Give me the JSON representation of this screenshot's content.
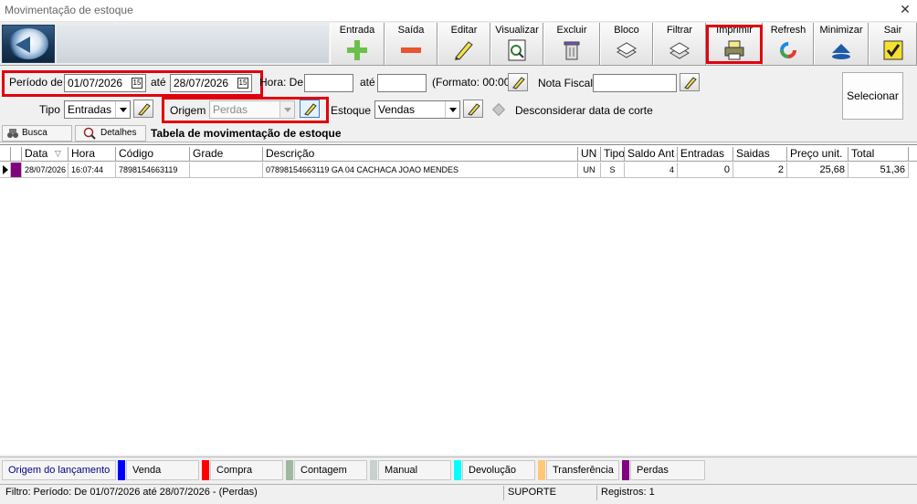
{
  "window": {
    "title": "Movimentação de estoque"
  },
  "toolbar": {
    "buttons": [
      {
        "label": "Entrada",
        "icon": "plus-icon"
      },
      {
        "label": "Saída",
        "icon": "minus-icon"
      },
      {
        "label": "Editar",
        "icon": "pencil-icon"
      },
      {
        "label": "Visualizar",
        "icon": "preview-icon"
      },
      {
        "label": "Excluir",
        "icon": "trash-icon"
      },
      {
        "label": "Bloco",
        "icon": "block-icon"
      },
      {
        "label": "Filtrar",
        "icon": "filter-icon"
      },
      {
        "label": "Imprimir",
        "icon": "printer-icon"
      },
      {
        "label": "Refresh",
        "icon": "refresh-icon"
      },
      {
        "label": "Minimizar",
        "icon": "minimize-icon"
      },
      {
        "label": "Sair",
        "icon": "exit-checkmark-icon"
      }
    ]
  },
  "filters": {
    "periodo_label": "Período de",
    "periodo_start": "01/07/2026",
    "ate_label": "até",
    "periodo_end": "28/07/2026",
    "hora_label": "Hora: De",
    "hora_start": "",
    "hora_ate_label": "até",
    "hora_end": "",
    "formato_label": "(Formato: 00:00)",
    "nota_fiscal_label": "Nota Fiscal",
    "nota_fiscal_value": "",
    "tipo_label": "Tipo",
    "tipo_value": "Entradas",
    "origem_label": "Origem",
    "origem_value": "Perdas",
    "estoque_label": "Estoque",
    "estoque_value": "Vendas",
    "desconsiderar_label": "Desconsiderar data de corte",
    "selecionar_label": "Selecionar"
  },
  "tabs": {
    "busca": "Busca",
    "detalhes": "Detalhes"
  },
  "table": {
    "title": "Tabela de movimentação de estoque",
    "columns": [
      "Data",
      "Hora",
      "Código",
      "Grade",
      "Descrição",
      "UN",
      "Tipo",
      "Saldo Ant",
      "Entradas",
      "Saidas",
      "Preço unit.",
      "Total"
    ],
    "rows": [
      {
        "data": "28/07/2026",
        "hora": "16:07:44",
        "codigo": "7898154663119",
        "grade": "",
        "descricao": "07898154663119 GA 04 CACHACA JOAO MENDES",
        "un": "UN",
        "tipo": "S",
        "saldo_ant": "4",
        "entradas": "0",
        "saidas": "2",
        "preco_unit": "25,68",
        "total": "51,36"
      }
    ]
  },
  "legend": {
    "title": "Origem do lançamento",
    "items": [
      {
        "label": "Venda",
        "color": "#0000ff"
      },
      {
        "label": "Compra",
        "color": "#ff0000"
      },
      {
        "label": "Contagem",
        "color": "#a0b8a0"
      },
      {
        "label": "Manual",
        "color": "#c8d0d0"
      },
      {
        "label": "Devolução",
        "color": "#00ffff"
      },
      {
        "label": "Transferência",
        "color": "#ffc878"
      },
      {
        "label": "Perdas",
        "color": "#800080"
      }
    ]
  },
  "status": {
    "filtro": "Filtro: Período: De 01/07/2026 até 28/07/2026 - (Perdas)",
    "usuario": "SUPORTE",
    "registros": "Registros: 1"
  },
  "colors": {
    "highlight_red": "#e0000d",
    "row_marker_purple": "#800080",
    "legend_title_blue": "#00008b"
  }
}
